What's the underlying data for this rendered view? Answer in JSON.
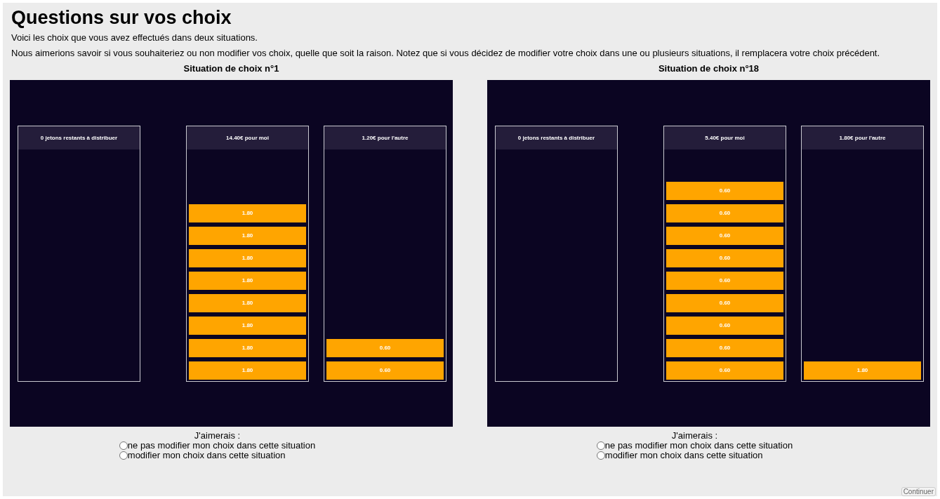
{
  "title": "Questions sur vos choix",
  "paragraphs": [
    "Voici les choix que vous avez effectués dans deux situations.",
    "Nous aimerions savoir si vous souhaiteriez ou non modifier vos choix, quelle que soit la raison. Notez que si vous décidez de modifier votre choix dans une ou plusieurs situations, il remplacera votre choix précédent."
  ],
  "situations": [
    {
      "heading": "Situation de choix n°1",
      "columns": [
        {
          "header": "0 jetons restants à distribuer"
        },
        {
          "header": "14.40€ pour moi",
          "tokens": [
            "1.80",
            "1.80",
            "1.80",
            "1.80",
            "1.80",
            "1.80",
            "1.80",
            "1.80"
          ]
        },
        {
          "header": "1.20€ pour l'autre",
          "tokens": [
            "0.60",
            "0.60"
          ]
        }
      ],
      "prompt": "J'aimerais :",
      "options": [
        {
          "label": "ne pas modifier mon choix dans cette situation",
          "selected": false
        },
        {
          "label": "modifier mon choix dans cette situation",
          "selected": false
        }
      ]
    },
    {
      "heading": "Situation de choix n°18",
      "columns": [
        {
          "header": "0 jetons restants à distribuer"
        },
        {
          "header": "5.40€ pour moi",
          "tokens": [
            "0.60",
            "0.60",
            "0.60",
            "0.60",
            "0.60",
            "0.60",
            "0.60",
            "0.60",
            "0.60"
          ]
        },
        {
          "header": "1.80€ pour l'autre",
          "tokens": [
            "1.80"
          ]
        }
      ],
      "prompt": "J'aimerais :",
      "options": [
        {
          "label": "ne pas modifier mon choix dans cette situation",
          "selected": false
        },
        {
          "label": "modifier mon choix dans cette situation",
          "selected": false
        }
      ]
    }
  ],
  "continue_button": "Continuer"
}
